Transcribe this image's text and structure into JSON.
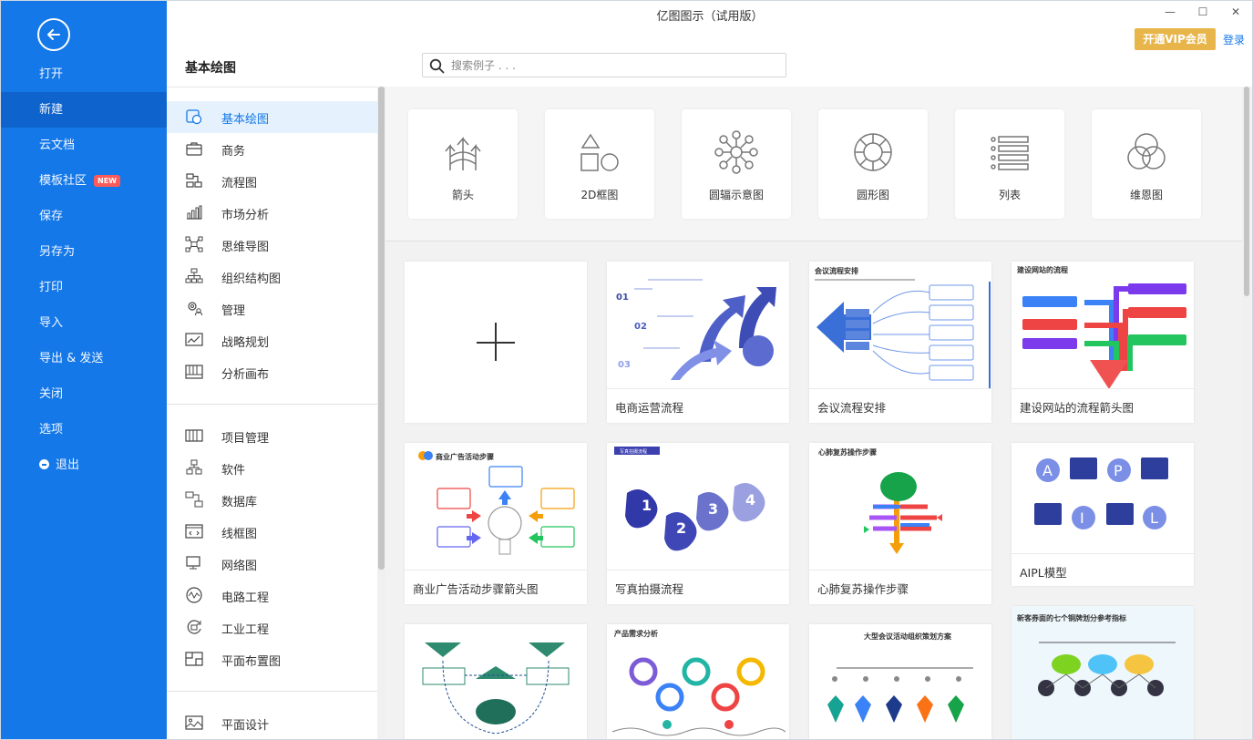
{
  "window": {
    "title": "亿图图示（试用版）",
    "minimize": "—",
    "maximize": "☐",
    "close": "✕"
  },
  "header": {
    "vip_button": "开通VIP会员",
    "login": "登录"
  },
  "sidebar": {
    "items": [
      {
        "label": "打开"
      },
      {
        "label": "新建"
      },
      {
        "label": "云文档"
      },
      {
        "label": "模板社区",
        "badge": "NEW"
      },
      {
        "label": "保存"
      },
      {
        "label": "另存为"
      },
      {
        "label": "打印"
      },
      {
        "label": "导入"
      },
      {
        "label": "导出 & 发送"
      },
      {
        "label": "关闭"
      },
      {
        "label": "选项"
      },
      {
        "label": "退出"
      }
    ]
  },
  "page": {
    "title": "基本绘图",
    "search_placeholder": "搜索例子 . . ."
  },
  "categories": {
    "group1": [
      {
        "label": "基本绘图",
        "icon": "basic-drawing-icon"
      },
      {
        "label": "商务",
        "icon": "briefcase-icon"
      },
      {
        "label": "流程图",
        "icon": "flowchart-icon"
      },
      {
        "label": "市场分析",
        "icon": "bar-chart-icon"
      },
      {
        "label": "思维导图",
        "icon": "mindmap-icon"
      },
      {
        "label": "组织结构图",
        "icon": "org-chart-icon"
      },
      {
        "label": "管理",
        "icon": "gear-people-icon"
      },
      {
        "label": "战略规划",
        "icon": "strategy-icon"
      },
      {
        "label": "分析画布",
        "icon": "canvas-icon"
      }
    ],
    "group2": [
      {
        "label": "项目管理",
        "icon": "project-icon"
      },
      {
        "label": "软件",
        "icon": "software-icon"
      },
      {
        "label": "数据库",
        "icon": "database-icon"
      },
      {
        "label": "线框图",
        "icon": "wireframe-icon"
      },
      {
        "label": "网络图",
        "icon": "network-icon"
      },
      {
        "label": "电路工程",
        "icon": "circuit-icon"
      },
      {
        "label": "工业工程",
        "icon": "industrial-icon"
      },
      {
        "label": "平面布置图",
        "icon": "floorplan-icon"
      }
    ],
    "group3": [
      {
        "label": "平面设计",
        "icon": "graphic-design-icon"
      }
    ]
  },
  "tiles": [
    {
      "label": "箭头",
      "icon": "arrows-icon"
    },
    {
      "label": "2D框图",
      "icon": "shapes-2d-icon"
    },
    {
      "label": "圆辐示意图",
      "icon": "radial-icon"
    },
    {
      "label": "圆形图",
      "icon": "circular-icon"
    },
    {
      "label": "列表",
      "icon": "list-icon"
    },
    {
      "label": "维恩图",
      "icon": "venn-icon"
    }
  ],
  "templates": [
    {
      "label": "",
      "kind": "new"
    },
    {
      "label": "电商运营流程",
      "thumb_title": ""
    },
    {
      "label": "会议流程安排",
      "thumb_title": "会议流程安排"
    },
    {
      "label": "建设网站的流程箭头图",
      "thumb_title": "建设网站的流程"
    },
    {
      "label": "商业广告活动步骤箭头图",
      "thumb_title": "商业广告活动步骤"
    },
    {
      "label": "写真拍摄流程",
      "thumb_title": "写真拍摄流程"
    },
    {
      "label": "心肺复苏操作步骤",
      "thumb_title": "心肺复苏操作步骤"
    },
    {
      "label": "AIPL模型",
      "thumb_title": ""
    },
    {
      "label": "",
      "thumb_title": ""
    },
    {
      "label": "",
      "thumb_title": "产品需求分析"
    },
    {
      "label": "",
      "thumb_title": "大型会议活动组织策划方案"
    },
    {
      "label": "",
      "thumb_title": "新客券面的七个铜牌划分参考指标"
    }
  ]
}
